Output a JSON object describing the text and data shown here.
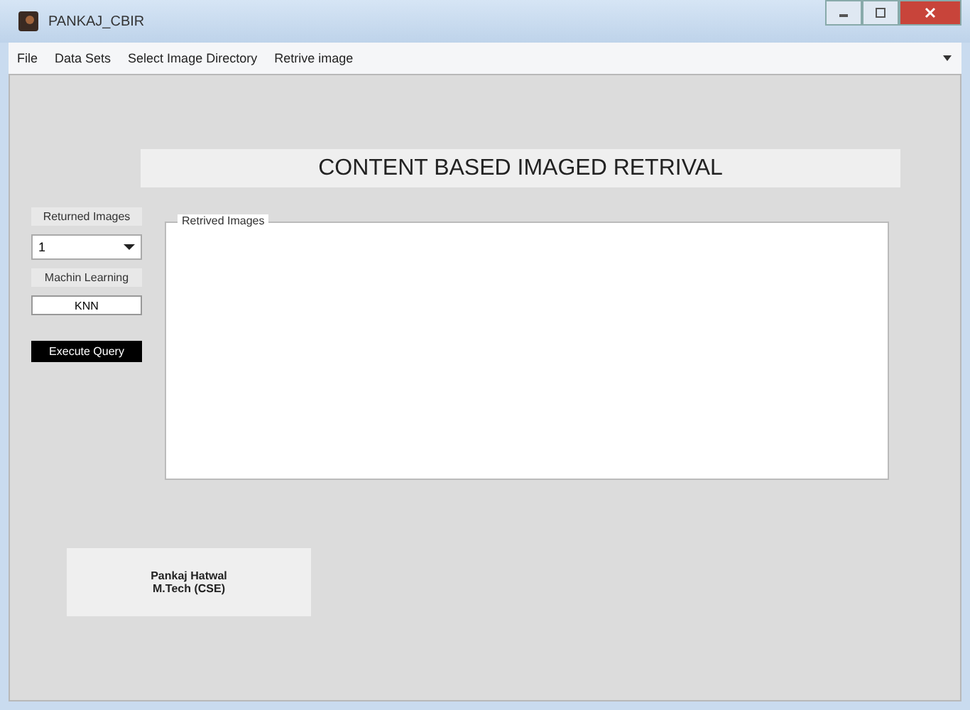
{
  "window": {
    "title": "PANKAJ_CBIR"
  },
  "menu": [
    "File",
    "Data Sets",
    "Select Image Directory",
    "Retrive image"
  ],
  "banner": "CONTENT BASED IMAGED RETRIVAL",
  "controls": {
    "returned_label": "Returned Images",
    "returned_value": "1",
    "learning_label": "Machin Learning",
    "learning_button": "KNN",
    "execute_button": "Execute Query"
  },
  "results_panel": {
    "title": "Retrived Images"
  },
  "credits": [
    "Pankaj Hatwal",
    "M.Tech (CSE)"
  ]
}
